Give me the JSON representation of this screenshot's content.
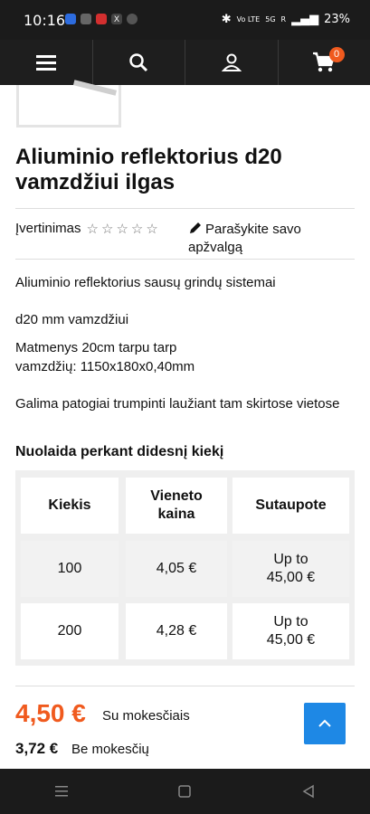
{
  "status_bar": {
    "time": "10:16",
    "battery": "23%",
    "network": "Vo LTE",
    "signal": "5G",
    "roaming": "R"
  },
  "nav": {
    "cart_count": "0",
    "icons": [
      "menu-icon",
      "search-icon",
      "user-icon",
      "cart-icon"
    ]
  },
  "product": {
    "title": "Aliuminio reflektorius d20 vamzdžiui ilgas",
    "rating_label": "Įvertinimas",
    "review_link": "Parašykite savo apžvalgą",
    "description": [
      "Aliuminio reflektorius sausų grindų sistemai",
      "d20 mm vamzdžiui",
      "Matmenys 20cm tarpu tarp vamzdžių: 1150x180x0,40mm",
      "Galima patogiai trumpinti laužiant tam skirtose vietose"
    ]
  },
  "discount": {
    "title": "Nuolaida perkant didesnį kiekį",
    "headers": [
      "Kiekis",
      "Vieneto kaina",
      "Sutaupote"
    ],
    "rows": [
      [
        "100",
        "4,05 €",
        "Up to 45,00 €"
      ],
      [
        "200",
        "4,28 €",
        "Up to 45,00 €"
      ]
    ]
  },
  "price": {
    "with_tax": "4,50 €",
    "with_tax_label": "Su mokesčiais",
    "without_tax": "3,72 €",
    "without_tax_label": "Be mokesčių"
  },
  "colors": {
    "accent": "#f05a1e",
    "nav_bg": "#1e1e1e",
    "scroll_top": "#1e88e5"
  }
}
